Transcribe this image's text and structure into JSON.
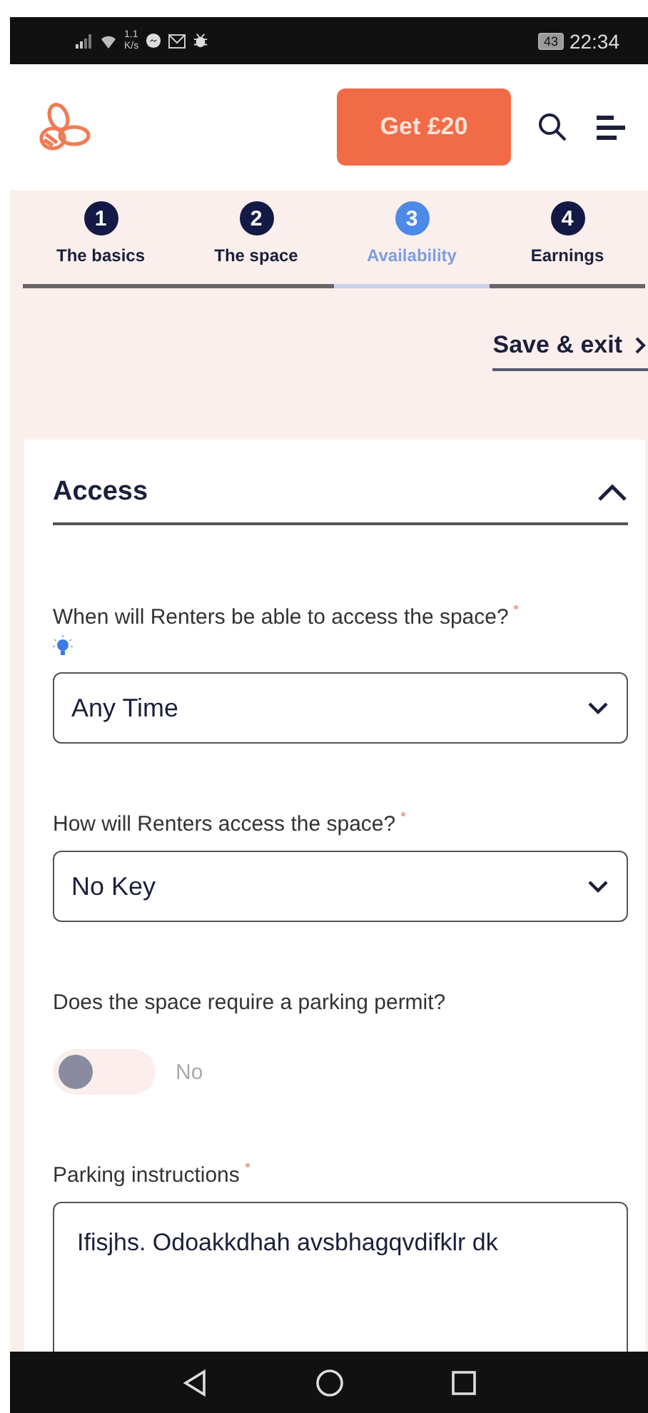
{
  "status_bar": {
    "speed": "1.1",
    "speed_unit": "K/s",
    "battery": "43",
    "time": "22:34"
  },
  "header": {
    "cta": "Get £20"
  },
  "steps": [
    {
      "number": "1",
      "label": "The basics",
      "selected": false
    },
    {
      "number": "2",
      "label": "The space",
      "selected": false
    },
    {
      "number": "3",
      "label": "Availability",
      "selected": true
    },
    {
      "number": "4",
      "label": "Earnings",
      "selected": false
    }
  ],
  "save_exit": "Save & exit",
  "section": {
    "title": "Access",
    "expanded": true
  },
  "fields": [
    {
      "kind": "select",
      "label": "When will Renters be able to access the space?",
      "required": true,
      "hint": true,
      "value": "Any Time"
    },
    {
      "kind": "select",
      "label": "How will Renters access the space?",
      "required": true,
      "hint": false,
      "value": "No Key"
    },
    {
      "kind": "toggle",
      "label": "Does the space require a parking permit?",
      "required": false,
      "hint": false,
      "on": false,
      "value": "No"
    },
    {
      "kind": "textarea",
      "label": "Parking instructions",
      "required": true,
      "hint": false,
      "value": "Ifisjhs. Odoakkdhah avsbhagqvdifklr dk"
    }
  ]
}
